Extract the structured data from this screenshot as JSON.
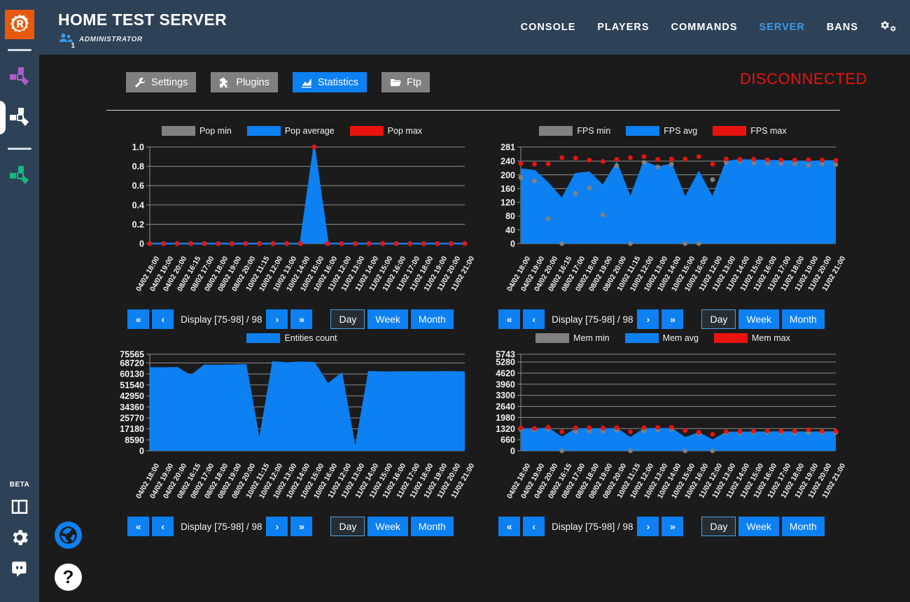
{
  "rail": {
    "logo_icon": "rust-r-logo",
    "servers": [
      {
        "name": "server-purple",
        "color": "#b05ccb",
        "active": false
      },
      {
        "name": "server-white",
        "color": "#ffffff",
        "active": true
      },
      {
        "name": "server-green",
        "color": "#16b77f",
        "active": false
      }
    ],
    "beta_label": "BETA",
    "bottom_icons": [
      {
        "name": "layout-columns-icon"
      },
      {
        "name": "gear-icon"
      },
      {
        "name": "discord-icon"
      }
    ]
  },
  "header": {
    "title": "HOME TEST SERVER",
    "players_icon": "people-icon",
    "players_count": "1",
    "role": "ADMINISTRATOR",
    "nav": [
      {
        "label": "CONSOLE",
        "active": false
      },
      {
        "label": "PLAYERS",
        "active": false
      },
      {
        "label": "COMMANDS",
        "active": false
      },
      {
        "label": "SERVER",
        "active": true
      },
      {
        "label": "BANS",
        "active": false
      }
    ],
    "settings_icon": "gears-icon",
    "accent_color": "#3d9ae8"
  },
  "toolbar": {
    "buttons": [
      {
        "label": "Settings",
        "icon": "wrench-icon",
        "active": false
      },
      {
        "label": "Plugins",
        "icon": "puzzle-icon",
        "active": false
      },
      {
        "label": "Statistics",
        "icon": "chart-icon",
        "active": true
      },
      {
        "label": "Ftp",
        "icon": "folder-icon",
        "active": false
      }
    ],
    "connection_status": "DISCONNECTED",
    "status_color": "#e8130f"
  },
  "pager": {
    "first_label": "«",
    "prev_label": "‹",
    "display_label": "Display [75-98] / 98",
    "next_label": "›",
    "last_label": "»",
    "ranges": [
      {
        "label": "Day",
        "selected": true
      },
      {
        "label": "Week",
        "selected": false
      },
      {
        "label": "Month",
        "selected": false
      }
    ]
  },
  "colors": {
    "min_series": "#808080",
    "avg_series": "#0d80f2",
    "max_series": "#e8130f",
    "grid": "#8d8d8d",
    "plot_bg": "#1b1b1b"
  },
  "x_labels": [
    "04/02 18:00",
    "04/02 19:00",
    "04/02 20:00",
    "08/02 16:15",
    "08/02 17:00",
    "08/02 18:00",
    "08/02 19:00",
    "08/02 20:00",
    "10/02 11:15",
    "10/02 12:00",
    "10/02 13:00",
    "10/02 14:00",
    "10/02 15:00",
    "10/02 16:00",
    "11/02 12:00",
    "11/02 13:00",
    "11/02 14:00",
    "11/02 15:00",
    "11/02 16:00",
    "11/02 17:00",
    "11/02 18:00",
    "11/02 19:00",
    "11/02 20:00",
    "11/02 21:00"
  ],
  "chart_data": [
    {
      "type": "area",
      "id": "pop",
      "title": "",
      "legend": [
        {
          "label": "Pop min",
          "color": "#808080"
        },
        {
          "label": "Pop average",
          "color": "#0d80f2"
        },
        {
          "label": "Pop max",
          "color": "#e8130f"
        }
      ],
      "legend_position": "top",
      "grid": true,
      "xlabel": "",
      "ylabel": "",
      "ylim": [
        0,
        1.0
      ],
      "yticks": [
        0,
        0.2,
        0.4,
        0.6,
        0.8,
        1.0
      ],
      "ytick_labels": [
        "0",
        "0.2",
        "0.4",
        "0.6",
        "0.8",
        "1.0"
      ],
      "x": [
        "04/02 18:00",
        "04/02 19:00",
        "04/02 20:00",
        "08/02 16:15",
        "08/02 17:00",
        "08/02 18:00",
        "08/02 19:00",
        "08/02 20:00",
        "10/02 11:15",
        "10/02 12:00",
        "10/02 13:00",
        "10/02 14:00",
        "10/02 15:00",
        "10/02 16:00",
        "11/02 12:00",
        "11/02 13:00",
        "11/02 14:00",
        "11/02 15:00",
        "11/02 16:00",
        "11/02 17:00",
        "11/02 18:00",
        "11/02 19:00",
        "11/02 20:00",
        "11/02 21:00"
      ],
      "series": [
        {
          "name": "Pop average",
          "color": "#0d80f2",
          "kind": "area",
          "values": [
            0,
            0,
            0,
            0,
            0,
            0,
            0,
            0,
            0,
            0,
            0,
            0,
            1.0,
            0,
            0,
            0,
            0,
            0,
            0,
            0,
            0,
            0,
            0,
            0
          ]
        },
        {
          "name": "Pop min",
          "color": "#808080",
          "kind": "points",
          "values": [
            0,
            0,
            0,
            0,
            0,
            0,
            0,
            0,
            0,
            0,
            0,
            0,
            1.0,
            0,
            0,
            0,
            0,
            0,
            0,
            0,
            0,
            0,
            0,
            0
          ]
        },
        {
          "name": "Pop max",
          "color": "#e8130f",
          "kind": "points",
          "values": [
            0,
            0,
            0,
            0,
            0,
            0,
            0,
            0,
            0,
            0,
            0,
            0,
            1.0,
            0,
            0,
            0,
            0,
            0,
            0,
            0,
            0,
            0,
            0,
            0
          ]
        }
      ],
      "pager": {
        "display_label": "Display [75-98] / 98"
      }
    },
    {
      "type": "area",
      "id": "fps",
      "title": "",
      "legend": [
        {
          "label": "FPS min",
          "color": "#808080"
        },
        {
          "label": "FPS avg",
          "color": "#0d80f2"
        },
        {
          "label": "FPS max",
          "color": "#e8130f"
        }
      ],
      "legend_position": "top",
      "grid": true,
      "xlabel": "",
      "ylabel": "",
      "ylim": [
        0,
        281
      ],
      "yticks": [
        0,
        40,
        80,
        120,
        160,
        200,
        240,
        281
      ],
      "ytick_labels": [
        "0",
        "40",
        "80",
        "120",
        "160",
        "200",
        "240",
        "281"
      ],
      "x": [
        "04/02 18:00",
        "04/02 19:00",
        "04/02 20:00",
        "08/02 16:15",
        "08/02 17:00",
        "08/02 18:00",
        "08/02 19:00",
        "08/02 20:00",
        "10/02 11:15",
        "10/02 12:00",
        "10/02 13:00",
        "10/02 14:00",
        "10/02 15:00",
        "10/02 16:00",
        "11/02 12:00",
        "11/02 13:00",
        "11/02 14:00",
        "11/02 15:00",
        "11/02 16:00",
        "11/02 17:00",
        "11/02 18:00",
        "11/02 19:00",
        "11/02 20:00",
        "11/02 21:00"
      ],
      "series": [
        {
          "name": "FPS avg",
          "color": "#0d80f2",
          "kind": "area",
          "values": [
            216,
            212,
            175,
            130,
            203,
            207,
            168,
            234,
            132,
            238,
            222,
            230,
            132,
            207,
            132,
            238,
            243,
            242,
            241,
            240,
            239,
            238,
            240,
            240
          ]
        },
        {
          "name": "FPS min",
          "color": "#808080",
          "kind": "points",
          "values": [
            192,
            182,
            72,
            0,
            146,
            162,
            84,
            226,
            0,
            236,
            223,
            231,
            0,
            0,
            186,
            236,
            240,
            234,
            234,
            233,
            232,
            228,
            232,
            230
          ]
        },
        {
          "name": "FPS max",
          "color": "#e8130f",
          "kind": "points",
          "values": [
            233,
            231,
            232,
            250,
            249,
            243,
            239,
            245,
            250,
            253,
            245,
            246,
            246,
            253,
            231,
            246,
            245,
            246,
            244,
            243,
            243,
            244,
            243,
            242
          ]
        }
      ],
      "pager": {
        "display_label": "Display [75-98] / 98"
      }
    },
    {
      "type": "area",
      "id": "entities",
      "title": "",
      "legend": [
        {
          "label": "Entities count",
          "color": "#0d80f2"
        }
      ],
      "legend_position": "top",
      "grid": true,
      "xlabel": "",
      "ylabel": "",
      "ylim": [
        0,
        75565
      ],
      "yticks": [
        0,
        8590,
        17180,
        25770,
        34360,
        42950,
        51540,
        60130,
        68720,
        75565
      ],
      "ytick_labels": [
        "0",
        "8590",
        "17180",
        "25770",
        "34360",
        "42950",
        "51540",
        "60130",
        "68720",
        "75565"
      ],
      "x": [
        "04/02 18:00",
        "04/02 19:00",
        "04/02 20:00",
        "08/02 16:15",
        "08/02 17:00",
        "08/02 18:00",
        "08/02 19:00",
        "08/02 20:00",
        "10/02 11:15",
        "10/02 12:00",
        "10/02 13:00",
        "10/02 14:00",
        "10/02 15:00",
        "10/02 16:00",
        "11/02 12:00",
        "11/02 13:00",
        "11/02 14:00",
        "11/02 15:00",
        "11/02 16:00",
        "11/02 17:00",
        "11/02 18:00",
        "11/02 19:00",
        "11/02 20:00",
        "11/02 21:00"
      ],
      "series": [
        {
          "name": "Entities count",
          "color": "#0d80f2",
          "kind": "area",
          "values": [
            64800,
            64600,
            64900,
            58500,
            66800,
            66600,
            66800,
            67200,
            7000,
            69300,
            68600,
            69100,
            68800,
            52000,
            60300,
            500,
            61700,
            61400,
            61500,
            61600,
            61500,
            61600,
            61700,
            61400
          ]
        }
      ],
      "pager": {
        "display_label": "Display [75-98] / 98"
      }
    },
    {
      "type": "area",
      "id": "mem",
      "title": "",
      "legend": [
        {
          "label": "Mem min",
          "color": "#808080"
        },
        {
          "label": "Mem avg",
          "color": "#0d80f2"
        },
        {
          "label": "Mem max",
          "color": "#e8130f"
        }
      ],
      "legend_position": "top",
      "grid": true,
      "xlabel": "",
      "ylabel": "",
      "ylim": [
        0,
        5743
      ],
      "yticks": [
        0,
        660,
        1320,
        1980,
        2640,
        3300,
        3960,
        4620,
        5280,
        5743
      ],
      "ytick_labels": [
        "0",
        "660",
        "1320",
        "1980",
        "2640",
        "3300",
        "3960",
        "4620",
        "5280",
        "5743"
      ],
      "x": [
        "04/02 18:00",
        "04/02 19:00",
        "04/02 20:00",
        "08/02 16:15",
        "08/02 17:00",
        "08/02 18:00",
        "08/02 19:00",
        "08/02 20:00",
        "10/02 11:15",
        "10/02 12:00",
        "10/02 13:00",
        "10/02 14:00",
        "10/02 15:00",
        "10/02 16:00",
        "11/02 12:00",
        "11/02 13:00",
        "11/02 14:00",
        "11/02 15:00",
        "11/02 16:00",
        "11/02 17:00",
        "11/02 18:00",
        "11/02 19:00",
        "11/02 20:00",
        "11/02 21:00"
      ],
      "series": [
        {
          "name": "Mem avg",
          "color": "#0d80f2",
          "kind": "area",
          "values": [
            1290,
            1270,
            1330,
            780,
            1280,
            1290,
            1280,
            1310,
            760,
            1290,
            1300,
            1310,
            760,
            1060,
            620,
            1080,
            1090,
            1090,
            1100,
            1110,
            1100,
            1090,
            1100,
            1110
          ]
        },
        {
          "name": "Mem min",
          "color": "#808080",
          "kind": "points",
          "values": [
            1270,
            1250,
            1290,
            0,
            1150,
            1180,
            1170,
            1230,
            0,
            1190,
            1240,
            1280,
            0,
            1010,
            0,
            1070,
            1070,
            1080,
            1090,
            1090,
            1080,
            1070,
            1090,
            1100
          ]
        },
        {
          "name": "Mem max",
          "color": "#e8130f",
          "kind": "points",
          "values": [
            1360,
            1330,
            1400,
            1140,
            1360,
            1370,
            1350,
            1380,
            1130,
            1380,
            1390,
            1400,
            1210,
            1100,
            980,
            1140,
            1150,
            1160,
            1180,
            1170,
            1160,
            1250,
            1160,
            1170
          ]
        }
      ],
      "pager": {
        "display_label": "Display [75-98] / 98"
      }
    }
  ],
  "fab": [
    {
      "name": "globe-icon",
      "color": "#0d80f2"
    },
    {
      "name": "help-icon",
      "label": "?",
      "color": "#ffffff"
    }
  ]
}
